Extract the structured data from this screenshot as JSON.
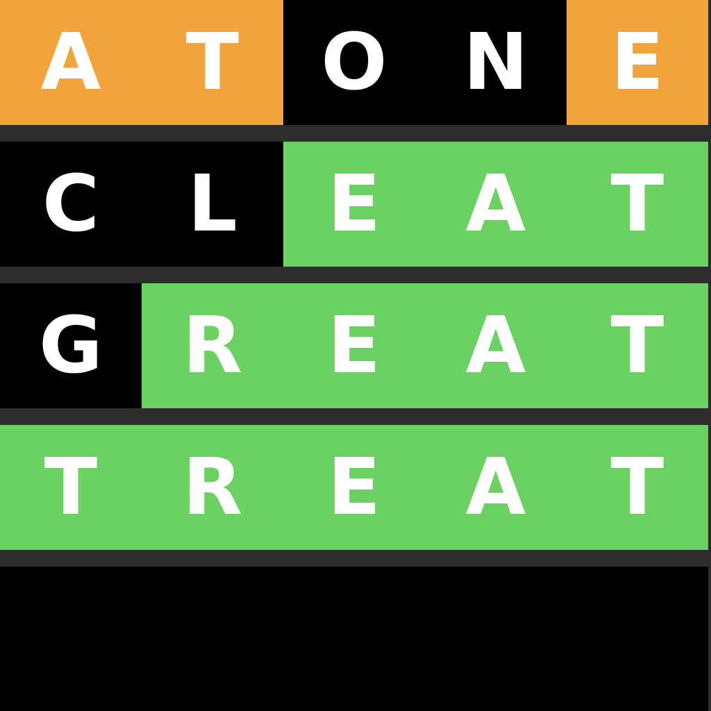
{
  "colors": {
    "present": "#f2a33c",
    "correct": "#6bd162",
    "absent": "#000000",
    "separator": "#2d2d2d",
    "letter": "#ffffff"
  },
  "board": {
    "rows": [
      {
        "tiles": [
          {
            "letter": "A",
            "state": "present"
          },
          {
            "letter": "T",
            "state": "present"
          },
          {
            "letter": "O",
            "state": "absent"
          },
          {
            "letter": "N",
            "state": "absent"
          },
          {
            "letter": "E",
            "state": "present"
          }
        ]
      },
      {
        "tiles": [
          {
            "letter": "C",
            "state": "absent"
          },
          {
            "letter": "L",
            "state": "absent"
          },
          {
            "letter": "E",
            "state": "correct"
          },
          {
            "letter": "A",
            "state": "correct"
          },
          {
            "letter": "T",
            "state": "correct"
          }
        ]
      },
      {
        "tiles": [
          {
            "letter": "G",
            "state": "absent"
          },
          {
            "letter": "R",
            "state": "correct"
          },
          {
            "letter": "E",
            "state": "correct"
          },
          {
            "letter": "A",
            "state": "correct"
          },
          {
            "letter": "T",
            "state": "correct"
          }
        ]
      },
      {
        "tiles": [
          {
            "letter": "T",
            "state": "correct"
          },
          {
            "letter": "R",
            "state": "correct"
          },
          {
            "letter": "E",
            "state": "correct"
          },
          {
            "letter": "A",
            "state": "correct"
          },
          {
            "letter": "T",
            "state": "correct"
          }
        ]
      }
    ]
  }
}
